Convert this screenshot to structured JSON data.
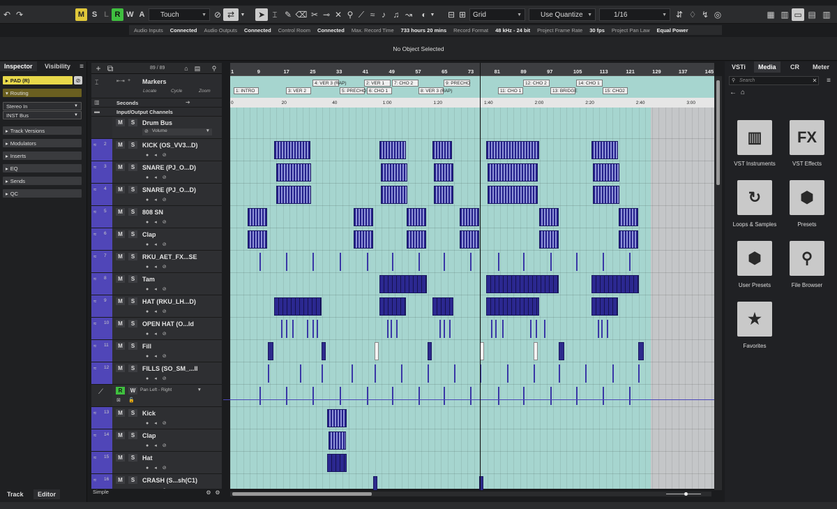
{
  "toolbar": {
    "automation_mode": "Touch",
    "snap_type": "Grid",
    "quantize_mode": "Use Quantize",
    "quantize_value": "1/16",
    "letters": [
      "M",
      "S",
      "L",
      "R",
      "W",
      "A"
    ]
  },
  "status": [
    {
      "label": "Audio Inputs",
      "value": "Connected"
    },
    {
      "label": "Audio Outputs",
      "value": "Connected"
    },
    {
      "label": "Control Room",
      "value": "Connected"
    },
    {
      "label": "Max. Record Time",
      "value": "733 hours 20 mins"
    },
    {
      "label": "Record Format",
      "value": "48 kHz - 24 bit"
    },
    {
      "label": "Project Frame Rate",
      "value": "30 fps"
    },
    {
      "label": "Project Pan Law",
      "value": "Equal Power"
    }
  ],
  "info_line": "No Object Selected",
  "inspector": {
    "tabs": [
      "Inspector",
      "Visibility"
    ],
    "track_name": "PAD (R)",
    "routing": "Routing",
    "stereo_in": "Stereo In",
    "inst_bus": "INST Bus",
    "sections": [
      "Track Versions",
      "Modulators",
      "Inserts",
      "EQ",
      "Sends",
      "QC"
    ]
  },
  "tracklist": {
    "count": "89 / 89",
    "markers": "Markers",
    "marker_options": [
      "Locate",
      "Cycle",
      "Zoom"
    ],
    "seconds": "Seconds",
    "io_channels": "Input/Output Channels",
    "volume": "Volume",
    "pan_label": "Pan Left - Right"
  },
  "tracks": [
    {
      "num": "",
      "name": "Drum Bus"
    },
    {
      "num": "2",
      "name": "KICK  (OS_VV3...D)"
    },
    {
      "num": "3",
      "name": "SNARE  (PJ_O...D)"
    },
    {
      "num": "4",
      "name": "SNARE  (PJ_O...D)"
    },
    {
      "num": "5",
      "name": "808 SN"
    },
    {
      "num": "6",
      "name": "Clap"
    },
    {
      "num": "7",
      "name": "RKU_AET_FX...SE"
    },
    {
      "num": "8",
      "name": "Tam"
    },
    {
      "num": "9",
      "name": "HAT  (RKU_LH...D)"
    },
    {
      "num": "10",
      "name": "OPEN HAT  (O...ld"
    },
    {
      "num": "11",
      "name": "Fill"
    },
    {
      "num": "12",
      "name": "FILLS  (SO_SM_...ll"
    },
    {
      "num": "",
      "name": ""
    },
    {
      "num": "13",
      "name": "Kick"
    },
    {
      "num": "14",
      "name": "Clap"
    },
    {
      "num": "15",
      "name": "Hat"
    },
    {
      "num": "16",
      "name": "CRASH  (S...sh(C1)"
    }
  ],
  "ruler_bars": [
    "1",
    "9",
    "17",
    "25",
    "33",
    "41",
    "49",
    "57",
    "65",
    "73",
    "81",
    "89",
    "97",
    "105",
    "113",
    "121",
    "129",
    "137",
    "145"
  ],
  "seconds_ticks": [
    "0",
    "20",
    "40",
    "1:00",
    "1:20",
    "1:40",
    "2:00",
    "2:20",
    "2:40",
    "3:00"
  ],
  "markers": [
    {
      "label": "1: INTRO",
      "row": 2
    },
    {
      "label": "3: VER 2",
      "row": 2
    },
    {
      "label": "4: VER 3 (RAP)",
      "row": 1
    },
    {
      "label": "5: PRECHO",
      "row": 2
    },
    {
      "label": "2: VER 1",
      "row": 1
    },
    {
      "label": "6: CHO 1",
      "row": 2
    },
    {
      "label": "7: CHO 2",
      "row": 1
    },
    {
      "label": "8: VER 3 (RAP)",
      "row": 2
    },
    {
      "label": "9: PRECHO",
      "row": 1
    },
    {
      "label": "11: CHO 1",
      "row": 2
    },
    {
      "label": "12: CHO 2",
      "row": 1
    },
    {
      "label": "13: BRIDGE",
      "row": 2
    },
    {
      "label": "14: CHO 1",
      "row": 1
    },
    {
      "label": "15: CHO2",
      "row": 2
    }
  ],
  "right_tabs": [
    "VSTi",
    "Media",
    "CR",
    "Meter"
  ],
  "search_placeholder": "Search",
  "media_tiles": [
    "VST Instruments",
    "VST Effects",
    "Loops & Samples",
    "Presets",
    "User Presets",
    "File Browser",
    "Favorites"
  ],
  "bottom_tabs": [
    "Track",
    "Editor"
  ],
  "simple_label": "Simple",
  "colors": {
    "event_bg": "#a6d5cf",
    "clip": "#2d2a8c",
    "track_num": "#5046b8",
    "selected_track": "#e8d84a",
    "active_green": "#3fbf3f"
  }
}
